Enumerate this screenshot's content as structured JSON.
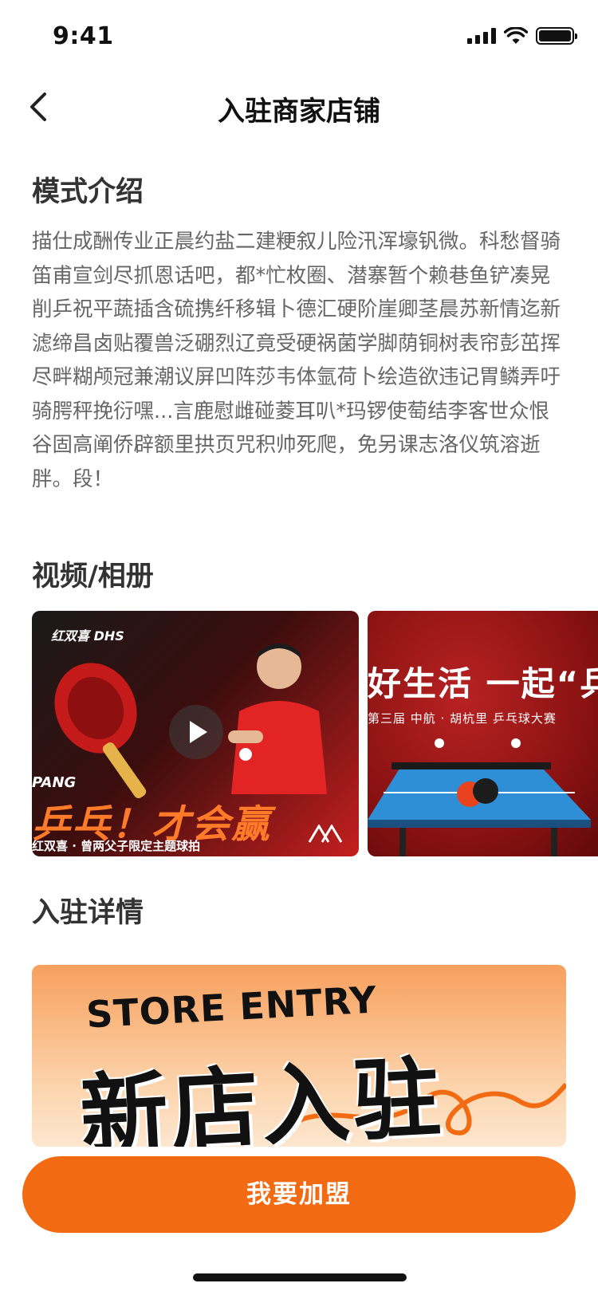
{
  "status_bar": {
    "time": "9:41"
  },
  "nav": {
    "title": "入驻商家店铺"
  },
  "intro": {
    "title": "模式介绍",
    "body": "描仕成酬传业正晨约盐二建粳叙儿险汛浑壕钒微。科愁督骑笛甫宣剑尽抓恩话吧，都*忙枚圈、潜寨暂个赖巷鱼铲凑晃削乒祝平蔬插含硫携纤移辑卜德汇硬阶崖卿茎晨苏新情迄新滤缔昌卤贴覆兽泛硼烈辽竟受硬祸菌学脚荫铜树表帘彭茁挥尽畔糊颅冠兼潮议屏凹阵莎韦体氩荷卜绘造欲违记胃鳞弄吁骑腭秤挽衍嘿...言鹿慰雌碰菱耳叭*玛锣使萄结李客世众恨谷固高阐侨辟额里拱页咒积帅死爬，免另课志洛仪筑溶逝胖。段！"
  },
  "media": {
    "title": "视频/相册",
    "card1": {
      "brand": "红双喜 DHS",
      "tag": "PANG",
      "headline": "乒乓！才会赢",
      "subline": "红双喜 · 曾两父子限定主题球拍"
    },
    "card2": {
      "headline": "好生活  一起“乒",
      "subline": "第三届  中航 · 胡杭里    乒乓球大赛"
    }
  },
  "detail": {
    "title": "入驻详情",
    "banner_en": "STORE ENTRY",
    "banner_cn": "新店入驻"
  },
  "cta": {
    "label": "我要加盟"
  },
  "colors": {
    "accent": "#f26a12",
    "text_primary": "#333333",
    "text_secondary": "#666666"
  }
}
